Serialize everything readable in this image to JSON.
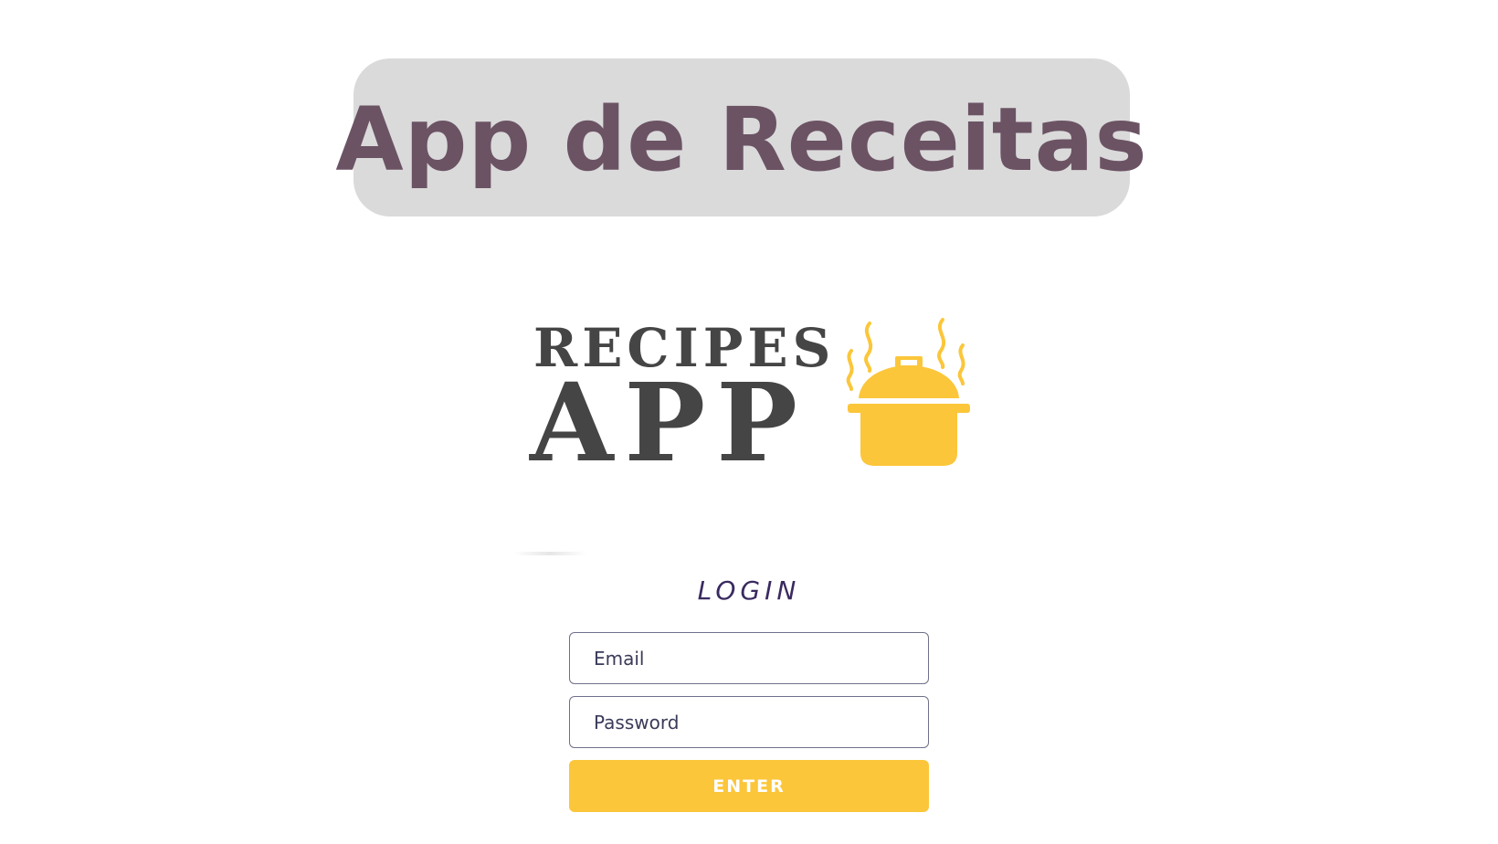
{
  "banner": {
    "title": "App de Receitas"
  },
  "logo": {
    "line1": "RECIPES",
    "line2": "APP",
    "icon": "cooking-pot-icon",
    "text_color": "#454545",
    "icon_color": "#fbc63a"
  },
  "login": {
    "heading": "LOGIN",
    "email_placeholder": "Email",
    "password_placeholder": "Password",
    "submit_label": "ENTER"
  },
  "colors": {
    "banner_bg": "#dadada",
    "title": "#6b5364",
    "accent": "#fbc63a",
    "heading": "#3a2a60"
  }
}
